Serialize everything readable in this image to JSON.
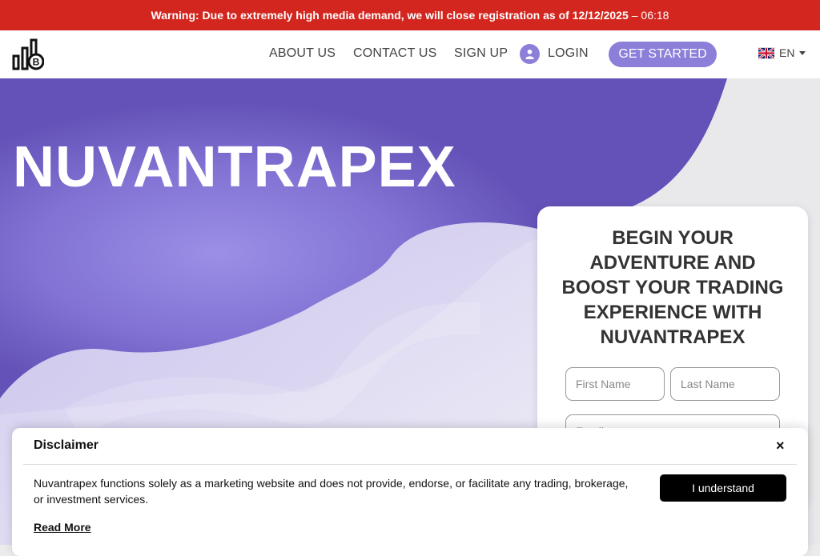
{
  "warning": {
    "text": "Warning: Due to extremely high media demand, we will close registration as of 12/12/2025",
    "time": "– 06:18"
  },
  "nav": {
    "about": "ABOUT US",
    "contact": "CONTACT US",
    "signup": "SIGN UP",
    "login": "LOGIN",
    "get_started": "GET STARTED",
    "language": "EN"
  },
  "hero": {
    "title": "NUVANTRAPEX"
  },
  "form": {
    "heading": "BEGIN YOUR ADVENTURE AND BOOST YOUR TRADING EXPERIENCE WITH NUVANTRAPEX",
    "first_name_placeholder": "First Name",
    "last_name_placeholder": "Last Name",
    "email_placeholder": "Email"
  },
  "disclaimer": {
    "title": "Disclaimer",
    "close": "×",
    "body": "Nuvantrapex functions solely as a marketing website and does not provide, endorse, or facilitate any trading, brokerage, or investment services.",
    "accept": "I understand",
    "read_more": "Read More"
  },
  "colors": {
    "warning_bar": "#d3261f",
    "accent": "#8b7fd9",
    "hero_purple": "#6f5fc4"
  },
  "icons": {
    "logo": "bar-chart-bitcoin-logo",
    "user": "user-icon",
    "flag": "uk-flag-icon",
    "caret": "caret-down-icon",
    "close": "close-icon"
  }
}
